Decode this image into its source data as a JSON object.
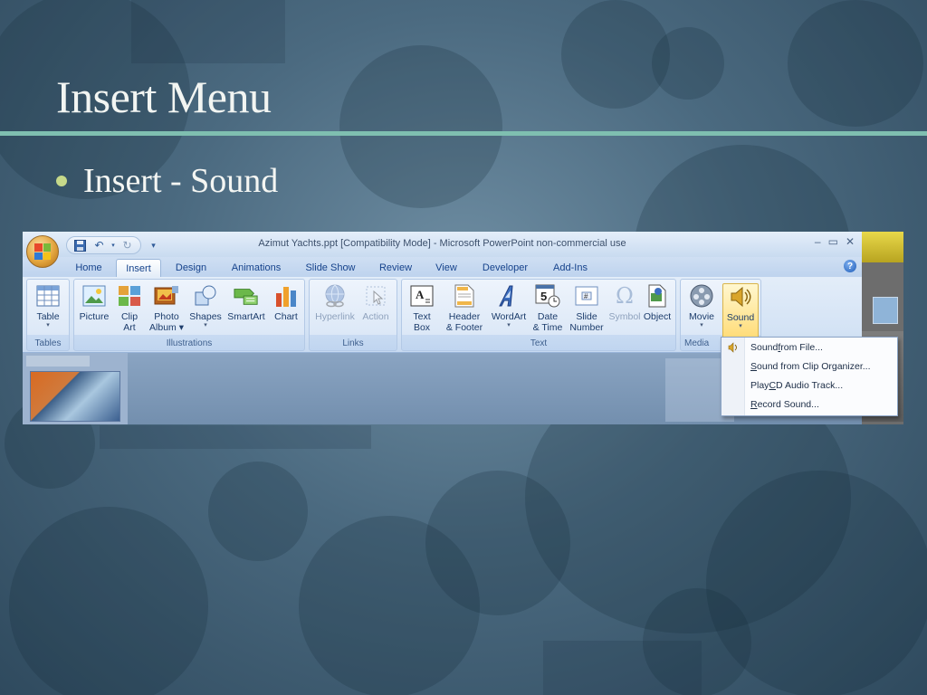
{
  "slide": {
    "title": "Insert Menu",
    "bullet": "Insert - Sound"
  },
  "colors": {
    "accent_rule": "#7fbfb0",
    "bullet": "#c6d98a",
    "ribbon_selected": "#ffd86b"
  },
  "window": {
    "title": "Azimut Yachts.ppt [Compatibility Mode] - Microsoft PowerPoint non-commercial use",
    "controls": [
      "–",
      "▭",
      "✕"
    ]
  },
  "qat_icons": [
    "save-icon",
    "undo-icon",
    "redo-icon",
    "customize-icon"
  ],
  "tabs": [
    {
      "label": "Home"
    },
    {
      "label": "Insert",
      "active": true
    },
    {
      "label": "Design"
    },
    {
      "label": "Animations"
    },
    {
      "label": "Slide Show"
    },
    {
      "label": "Review"
    },
    {
      "label": "View"
    },
    {
      "label": "Developer"
    },
    {
      "label": "Add-Ins"
    }
  ],
  "groups": [
    {
      "label": "Tables"
    },
    {
      "label": "Illustrations"
    },
    {
      "label": "Links"
    },
    {
      "label": "Text"
    },
    {
      "label": "Media"
    }
  ],
  "commands": {
    "table": {
      "line1": "Table",
      "line2": ""
    },
    "picture": {
      "line1": "Picture",
      "line2": ""
    },
    "clip_art": {
      "line1": "Clip",
      "line2": "Art"
    },
    "photo_album": {
      "line1": "Photo",
      "line2": "Album ▾"
    },
    "shapes": {
      "line1": "Shapes",
      "line2": ""
    },
    "smartart": {
      "line1": "SmartArt",
      "line2": ""
    },
    "chart": {
      "line1": "Chart",
      "line2": ""
    },
    "hyperlink": {
      "line1": "Hyperlink",
      "line2": ""
    },
    "action": {
      "line1": "Action",
      "line2": ""
    },
    "text_box": {
      "line1": "Text",
      "line2": "Box"
    },
    "header_footer": {
      "line1": "Header",
      "line2": "& Footer"
    },
    "wordart": {
      "line1": "WordArt",
      "line2": ""
    },
    "date_time": {
      "line1": "Date",
      "line2": "& Time"
    },
    "slide_number": {
      "line1": "Slide",
      "line2": "Number"
    },
    "symbol": {
      "line1": "Symbol",
      "line2": ""
    },
    "object": {
      "line1": "Object",
      "line2": ""
    },
    "movie": {
      "line1": "Movie",
      "line2": ""
    },
    "sound": {
      "line1": "Sound",
      "line2": ""
    }
  },
  "sound_menu": {
    "items": [
      {
        "pre": "Sound ",
        "key": "f",
        "post": "rom File..."
      },
      {
        "pre": "",
        "key": "S",
        "post": "ound from Clip Organizer..."
      },
      {
        "pre": "Play ",
        "key": "C",
        "post": "D Audio Track..."
      },
      {
        "pre": "",
        "key": "R",
        "post": "ecord Sound..."
      }
    ]
  }
}
